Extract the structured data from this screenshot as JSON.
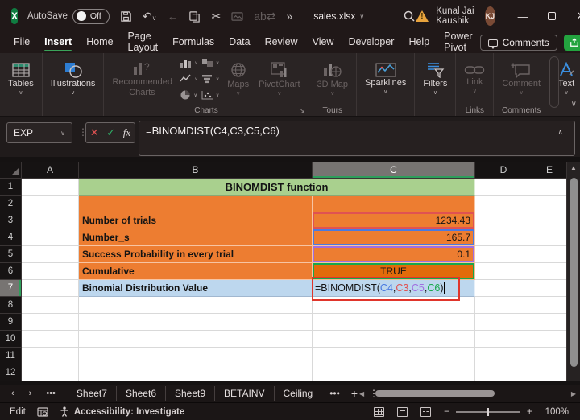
{
  "titlebar": {
    "autosave_label": "AutoSave",
    "autosave_state": "Off",
    "filename": "sales.xlsx",
    "user": "Kunal Jai Kaushik",
    "initials": "KJ"
  },
  "tabs": [
    "File",
    "Insert",
    "Home",
    "Page Layout",
    "Formulas",
    "Data",
    "Review",
    "View",
    "Developer",
    "Help",
    "Power Pivot"
  ],
  "active_tab": "Insert",
  "comments_button": "Comments",
  "ribbon": {
    "buttons": {
      "tables": "Tables",
      "illustrations": "Illustrations",
      "recommended_charts": "Recommended Charts",
      "maps": "Maps",
      "pivotchart": "PivotChart",
      "map3d": "3D Map",
      "sparklines": "Sparklines",
      "filters": "Filters",
      "link": "Link",
      "comment": "Comment",
      "text": "Text"
    },
    "group_labels": {
      "charts": "Charts",
      "tours": "Tours",
      "links": "Links",
      "comments": "Comments"
    }
  },
  "formula_bar": {
    "name_box": "EXP",
    "formula": "=BINOMDIST(C4,C3,C5,C6)"
  },
  "grid": {
    "columns": [
      "A",
      "B",
      "C",
      "D",
      "E"
    ],
    "selected_column": "C",
    "rows": [
      "1",
      "2",
      "3",
      "4",
      "5",
      "6",
      "7",
      "8",
      "9",
      "10",
      "11",
      "12"
    ],
    "selected_row": "7"
  },
  "sheet": {
    "title": "BINOMDIST function",
    "items": [
      {
        "label": "Number of trials",
        "value": "1234.43"
      },
      {
        "label": "Number_s",
        "value": "165.7"
      },
      {
        "label": "Success Probability in every trial",
        "value": "0.1"
      },
      {
        "label": "Cumulative",
        "value": "TRUE"
      },
      {
        "label": "Binomial Distribution Value",
        "value": "=BINOMDIST(C4,C3,C5,C6)"
      }
    ],
    "formula_parts": [
      {
        "text": "=BINOMDIST("
      },
      {
        "text": "C4"
      },
      {
        "text": ","
      },
      {
        "text": "C3"
      },
      {
        "text": ","
      },
      {
        "text": "C5"
      },
      {
        "text": ","
      },
      {
        "text": "C6"
      },
      {
        "text": ")"
      }
    ]
  },
  "sheet_tabs": [
    "Sheet7",
    "Sheet6",
    "Sheet9",
    "BETAINV",
    "Ceiling"
  ],
  "statusbar": {
    "mode": "Edit",
    "accessibility": "Accessibility: Investigate",
    "zoom": "100%"
  },
  "colors": {
    "accent_green": "#2e9e5b",
    "share_green": "#23a33f",
    "cell_title_green": "#A9D08E",
    "cell_orange": "#ED7D31",
    "cell_orange_dark": "#E26B0A",
    "cell_blue": "#BDD7EE",
    "ref_blue": "#4a7ae0",
    "ref_red": "#e05252",
    "ref_purple": "#a06ee0",
    "ref_green": "#17a84b",
    "annotation_red": "#e0352b",
    "warning_amber": "#E8A33D"
  }
}
